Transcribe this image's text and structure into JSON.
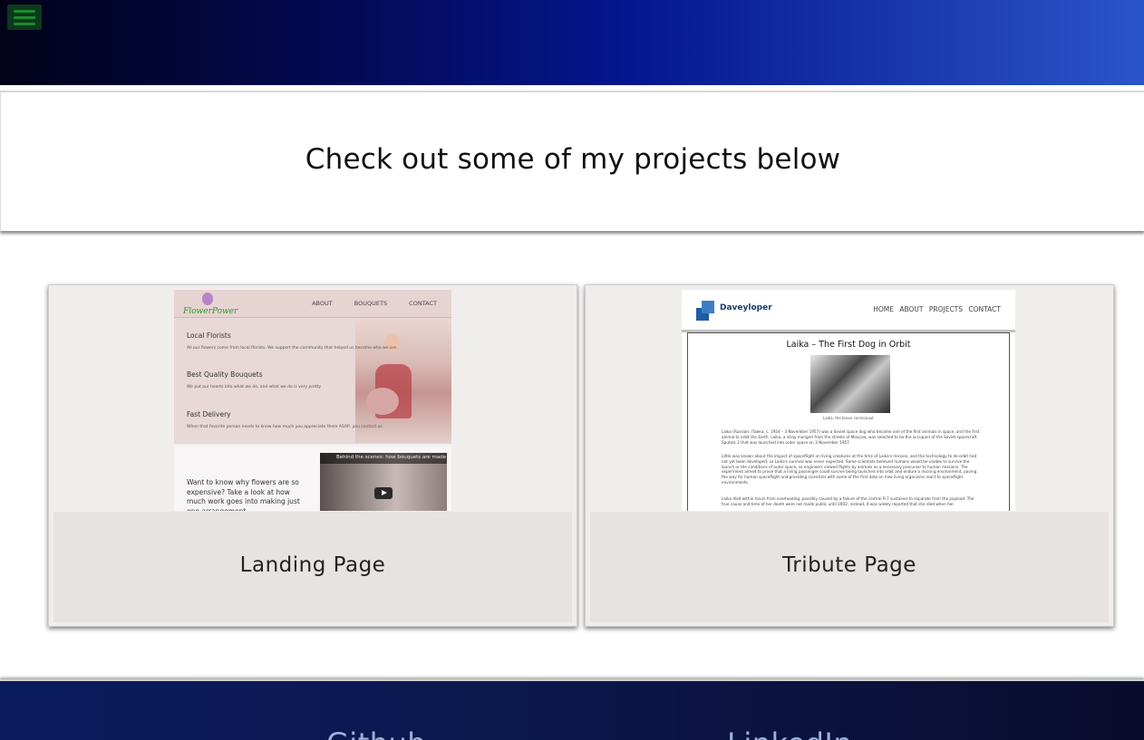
{
  "header": {
    "menu_icon": "hamburger-icon"
  },
  "intro": {
    "heading": "Check out some of my projects below"
  },
  "projects": [
    {
      "title": "Landing Page",
      "preview": {
        "brand": "FlowerPower",
        "nav": [
          "ABOUT",
          "BOUQUETS",
          "CONTACT"
        ],
        "features": [
          {
            "heading": "Local Florists",
            "text": "All our flowers come from local florists. We support the community that helped us become who we are"
          },
          {
            "heading": "Best Quality Bouquets",
            "text": "We put our hearts into what we do, and what we do is very pretty"
          },
          {
            "heading": "Fast Delivery",
            "text": "When that favorite person needs to know how much you appreciate them ASAP, you contact us"
          }
        ],
        "question": "Want to know why flowers are so expensive? Take a look at how much work goes into making just one arrangement",
        "video_title": "Behind the scenes: how bouquets are made"
      }
    },
    {
      "title": "Tribute Page",
      "preview": {
        "brand": "Daveyloper",
        "nav": [
          "HOME",
          "ABOUT",
          "PROJECTS",
          "CONTACT"
        ],
        "heading": "Laika – The First Dog in Orbit",
        "caption": "Laika, the brave cosmonaut",
        "paragraphs": [
          "Laika (Russian: Лайка; c. 1954 – 3 November 1957) was a Soviet space dog who became one of the first animals in space, and the first animal to orbit the Earth. Laika, a stray mongrel from the streets of Moscow, was selected to be the occupant of the Soviet spacecraft Sputnik 2 that was launched into outer space on 3 November 1957.",
          "Little was known about the impact of spaceflight on living creatures at the time of Laika's mission, and the technology to de-orbit had not yet been developed, so Laika's survival was never expected. Some scientists believed humans would be unable to survive the launch or the conditions of outer space, so engineers viewed flights by animals as a necessary precursor to human missions. The experiment aimed to prove that a living passenger could survive being launched into orbit and endure a micro-g environment, paving the way for human spaceflight and providing scientists with some of the first data on how living organisms react to spaceflight environments.",
          "Laika died within hours from overheating, possibly caused by a failure of the central R-7 sustainer to separate from the payload. The true cause and time of her death were not made public until 2002; instead, it was widely reported that she died when her"
        ]
      }
    }
  ],
  "footer": {
    "links": [
      "Github",
      "LinkedIn"
    ]
  }
}
